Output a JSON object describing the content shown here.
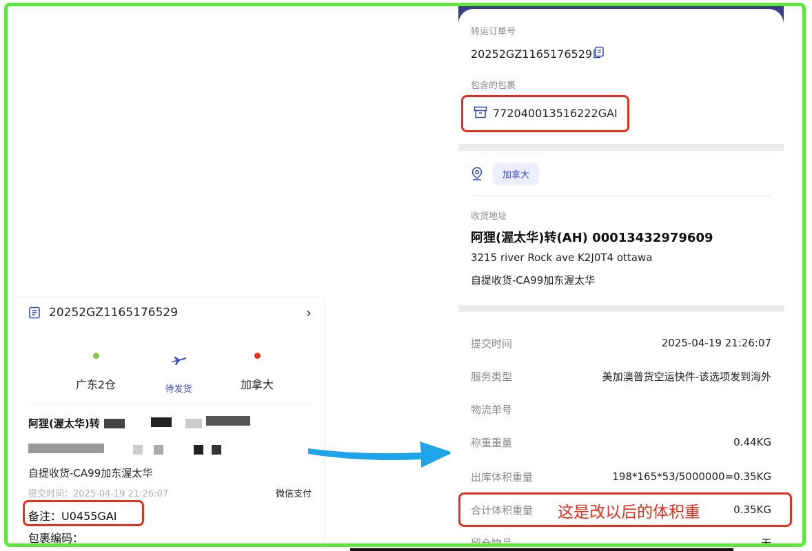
{
  "left_card": {
    "order_no": "20252GZ1165176529",
    "chevron": "›",
    "route": {
      "origin": "广东2仓",
      "status": "待发货",
      "destination": "加拿大",
      "origin_dot_color": "#8bc34a",
      "destination_dot_color": "#e4311f"
    },
    "recipient_name_partial": "阿狸(渥太华)转",
    "pickup": "自提收货-CA99加东渥太华",
    "submit_time": "提交时间：2025-04-19 21:26:07",
    "payment": "微信支付",
    "remark": "备注：U0455GAI",
    "package_code_label": "包裹编码："
  },
  "right_card": {
    "transfer_order_label": "转运订单号",
    "transfer_order_no": "20252GZ1165176529",
    "packages_label": "包含的包裹",
    "package_no": "772040013516222GAI",
    "country": "加拿大",
    "address_label": "收货地址",
    "recipient": "阿狸(渥太华)转(AH)   00013432979609",
    "address": "3215 river Rock ave K2J0T4 ottawa",
    "pickup": "自提收货-CA99加东渥太华",
    "rows": [
      {
        "key": "提交时间",
        "value": "2025-04-19 21:26:07"
      },
      {
        "key": "服务类型",
        "value": "美加澳普货空运快件-该选项发到海外"
      },
      {
        "key": "物流单号",
        "value": ""
      },
      {
        "key": "称重重量",
        "value": "0.44KG"
      },
      {
        "key": "出库体积重量",
        "value": "198*165*53/5000000=0.35KG"
      },
      {
        "key": "合计体积重量",
        "value": "0.35KG"
      },
      {
        "key": "留仓物品",
        "value": "无"
      }
    ],
    "annotation": "这是改以后的体积重"
  },
  "colors": {
    "frame": "#5ee83a",
    "highlight": "#e4311f",
    "accent": "#3b4bc0",
    "arrow": "#1ea5e9"
  }
}
